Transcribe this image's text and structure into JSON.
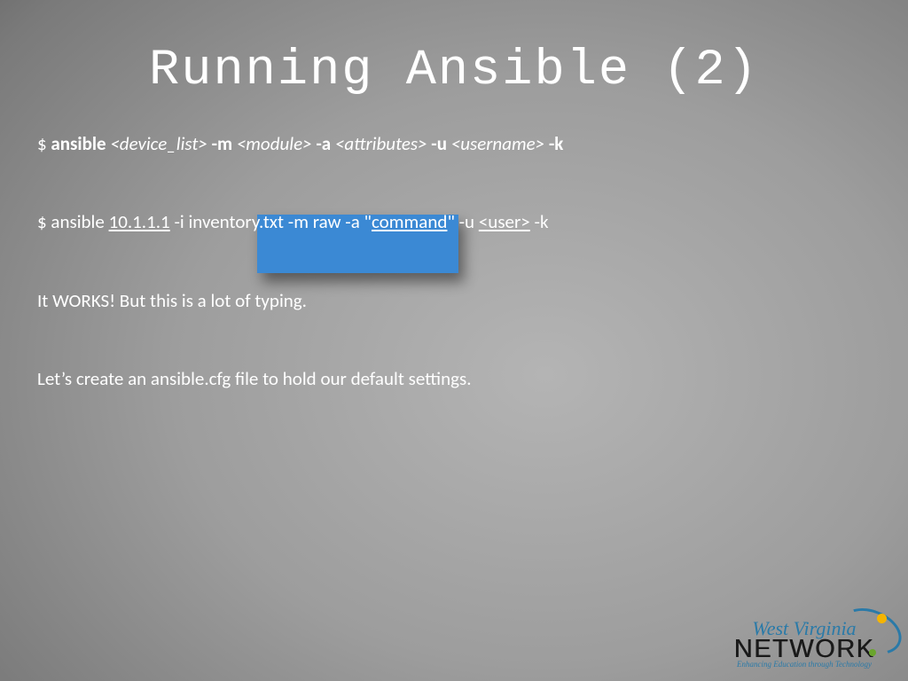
{
  "title": "Running Ansible (2)",
  "syntax": {
    "prompt": "$ ",
    "cmd": "ansible ",
    "device_list": "<device_list>",
    "m_flag": " -m ",
    "module": "<module>",
    "a_flag": " -a ",
    "attributes": "<attributes>",
    "u_flag": " -u ",
    "username": "<username>",
    "k_flag": " -k"
  },
  "example": {
    "pre": "$ ansible ",
    "ip": "10.1.1.1",
    "mid1": " -i inventory.txt -m raw -a \"",
    "command": "command",
    "mid2": "\" -u ",
    "user": "<user>",
    "tail": " -k"
  },
  "line3": "It WORKS!  But this is a lot of typing.",
  "line4": "Let’s create an ansible.cfg file to hold our default settings.",
  "logo": {
    "wv": "West Virginia",
    "network": "NETWORK",
    "tag": "Enhancing Education through Technology"
  }
}
